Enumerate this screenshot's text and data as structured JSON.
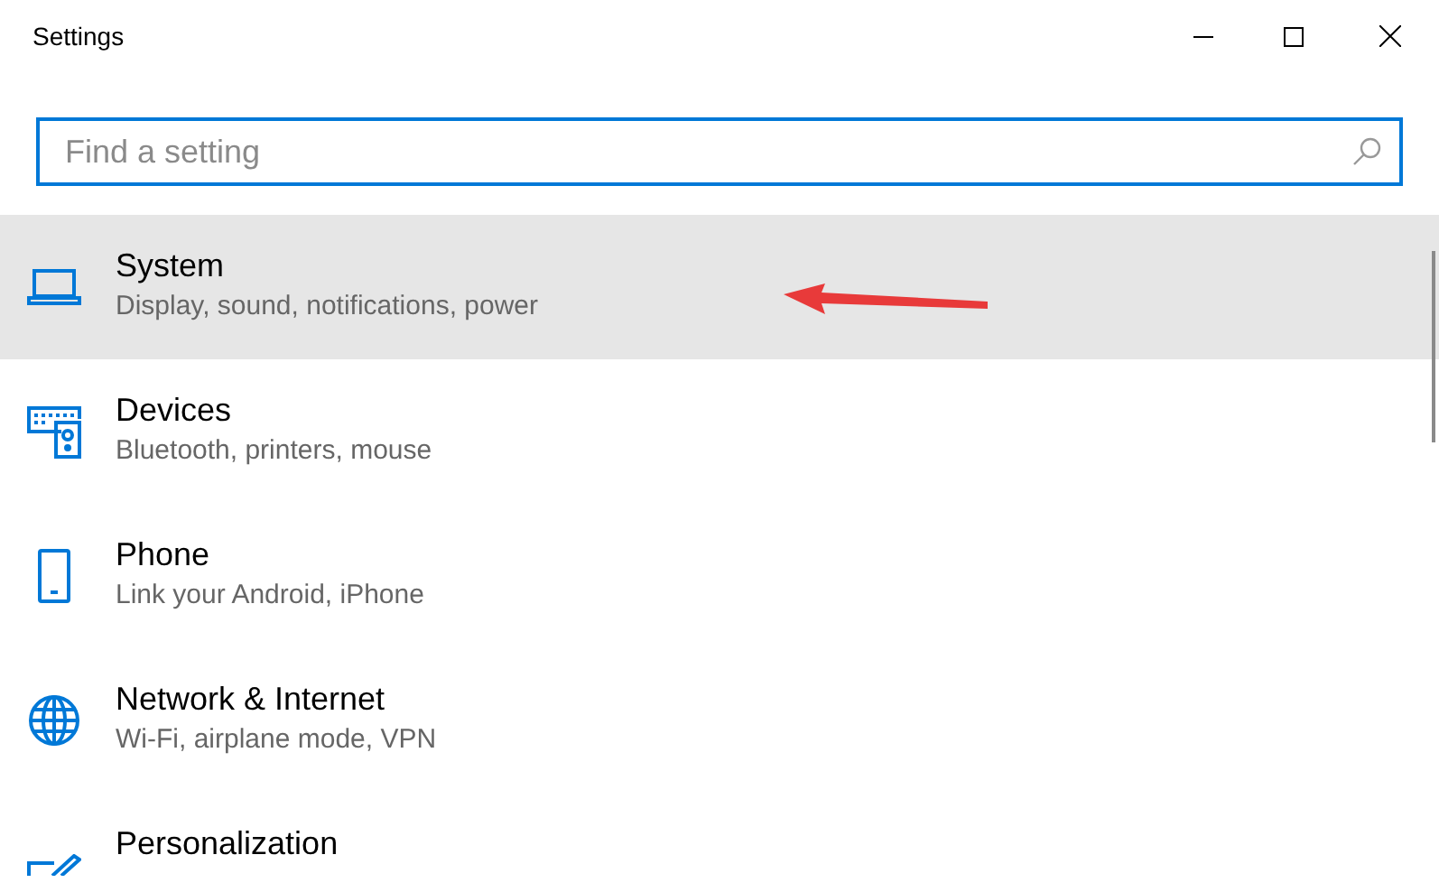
{
  "window": {
    "title": "Settings"
  },
  "search": {
    "placeholder": "Find a setting"
  },
  "items": [
    {
      "kind": "laptop",
      "label": "System",
      "description": "Display, sound, notifications, power",
      "selected": true
    },
    {
      "kind": "devices",
      "label": "Devices",
      "description": "Bluetooth, printers, mouse",
      "selected": false
    },
    {
      "kind": "phone",
      "label": "Phone",
      "description": "Link your Android, iPhone",
      "selected": false
    },
    {
      "kind": "globe",
      "label": "Network & Internet",
      "description": "Wi-Fi, airplane mode, VPN",
      "selected": false
    },
    {
      "kind": "brush",
      "label": "Personalization",
      "selected": false
    }
  ]
}
